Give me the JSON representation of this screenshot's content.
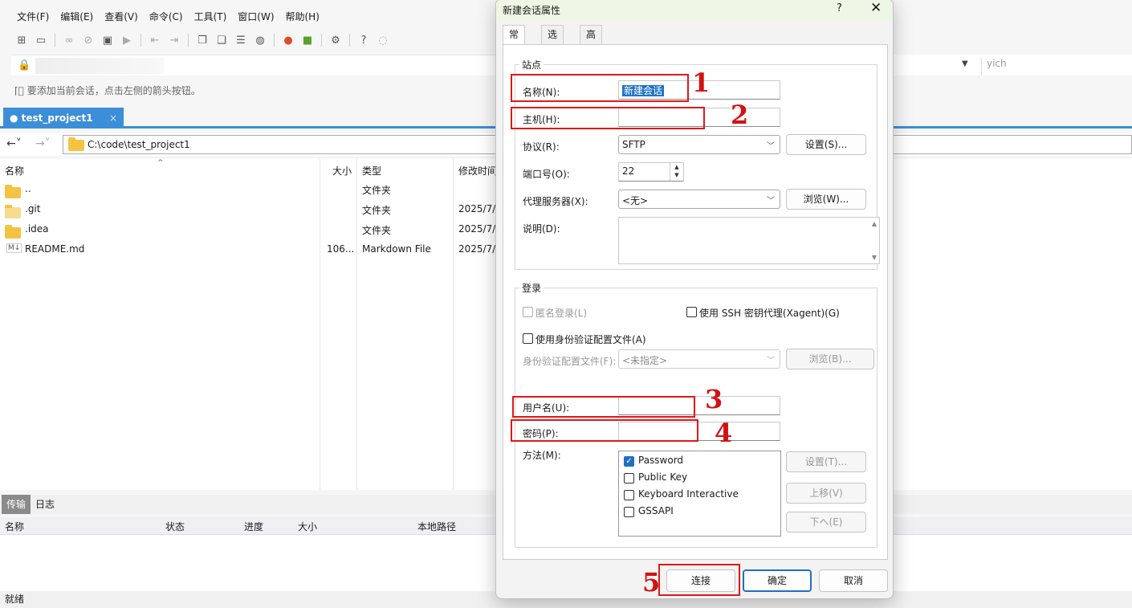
{
  "menu": [
    "文件(F)",
    "编辑(E)",
    "查看(V)",
    "命令(C)",
    "工具(T)",
    "窗口(W)",
    "帮助(H)"
  ],
  "hint": "要添加当前会话，点击左侧的箭头按钮。",
  "tab_label": "test_project1",
  "path": "C:\\code\\test_project1",
  "right_text": "yich",
  "file_columns": {
    "name": "名称",
    "size": "大小",
    "type": "类型",
    "modified": "修改时间"
  },
  "files": [
    {
      "name": "..",
      "size": "",
      "type": "文件夹",
      "modified": ""
    },
    {
      "name": ".git",
      "size": "",
      "type": "文件夹",
      "modified": "2025/7/"
    },
    {
      "name": ".idea",
      "size": "",
      "type": "文件夹",
      "modified": "2025/7/"
    },
    {
      "name": "README.md",
      "size": "106...",
      "type": "Markdown File",
      "modified": "2025/7/"
    }
  ],
  "bottom_tabs": {
    "transfer": "传输",
    "log": "日志"
  },
  "transfer_columns": {
    "name": "名称",
    "status": "状态",
    "progress": "进度",
    "size": "大小",
    "local": "本地路径"
  },
  "status": "就绪",
  "dialog": {
    "title": "新建会话属性",
    "help": "?",
    "tabs": [
      "常规",
      "选项",
      "高级"
    ],
    "site_group": "站点",
    "name_label": "名称(N):",
    "name_value": "新建会话",
    "host_label": "主机(H):",
    "host_value": "",
    "protocol_label": "协议(R):",
    "protocol_value": "SFTP",
    "settings_btn": "设置(S)...",
    "port_label": "端口号(O):",
    "port_value": "22",
    "proxy_label": "代理服务器(X):",
    "proxy_value": "<无>",
    "browse_btn": "浏览(W)...",
    "desc_label": "说明(D):",
    "login_group": "登录",
    "anon_label": "匿名登录(L)",
    "ssh_agent_label": "使用 SSH 密钥代理(Xagent)(G)",
    "use_profile_label": "使用身份验证配置文件(A)",
    "profile_label": "身份验证配置文件(F):",
    "profile_value": "<未指定>",
    "profile_browse_btn": "浏览(B)...",
    "user_label": "用户名(U):",
    "pass_label": "密码(P):",
    "method_label": "方法(M):",
    "methods": [
      {
        "label": "Password",
        "checked": true
      },
      {
        "label": "Public Key",
        "checked": false
      },
      {
        "label": "Keyboard Interactive",
        "checked": false
      },
      {
        "label": "GSSAPI",
        "checked": false
      }
    ],
    "method_settings_btn": "设置(T)...",
    "up_btn": "上移(V)",
    "down_btn": "下へ(E)",
    "connect_btn": "连接",
    "ok_btn": "确定",
    "cancel_btn": "取消"
  },
  "annotations": [
    "1",
    "2",
    "3",
    "4",
    "5"
  ]
}
